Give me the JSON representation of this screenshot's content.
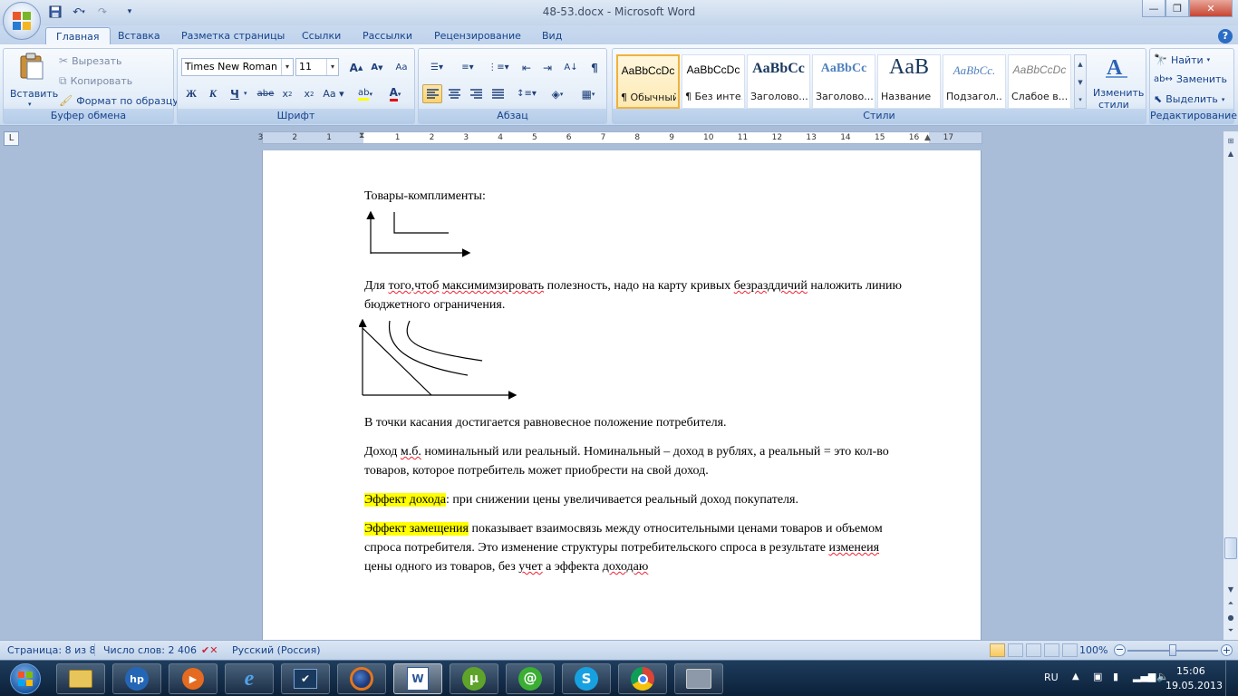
{
  "window": {
    "title": "48-53.docx - Microsoft Word"
  },
  "tabs": [
    {
      "label": "Главная",
      "active": true
    },
    {
      "label": "Вставка"
    },
    {
      "label": "Разметка страницы"
    },
    {
      "label": "Ссылки"
    },
    {
      "label": "Рассылки"
    },
    {
      "label": "Рецензирование"
    },
    {
      "label": "Вид"
    }
  ],
  "clipboard": {
    "paste": "Вставить",
    "cut": "Вырезать",
    "copy": "Копировать",
    "format_painter": "Формат по образцу",
    "label": "Буфер обмена"
  },
  "font": {
    "name": "Times New Roman",
    "size": "11",
    "label": "Шрифт"
  },
  "paragraph": {
    "label": "Абзац"
  },
  "styles": {
    "label": "Стили",
    "items": [
      {
        "sample": "AaBbCcDc",
        "name": "¶ Обычный",
        "selected": true
      },
      {
        "sample": "AaBbCcDc",
        "name": "¶ Без инте..."
      },
      {
        "sample": "AaBbCc",
        "name": "Заголово..."
      },
      {
        "sample": "AaBbCc",
        "name": "Заголово..."
      },
      {
        "sample": "AaB",
        "name": "Название"
      },
      {
        "sample": "AaBbCc.",
        "name": "Подзагол..."
      },
      {
        "sample": "AaBbCcDc",
        "name": "Слабое в..."
      }
    ],
    "change_styles_1": "Изменить",
    "change_styles_2": "стили"
  },
  "editing": {
    "find": "Найти",
    "replace": "Заменить",
    "select": "Выделить",
    "label": "Редактирование"
  },
  "ruler": {
    "numbers": [
      "3",
      "2",
      "1",
      "1",
      "2",
      "3",
      "4",
      "5",
      "6",
      "7",
      "8",
      "9",
      "10",
      "11",
      "12",
      "13",
      "14",
      "15",
      "16",
      "17"
    ]
  },
  "document": {
    "p1": "Товары-комплименты:",
    "p2a": "Для ",
    "p2b": "того,чтоб",
    "p2c": " ",
    "p2d": "максимимзировать",
    "p2e": " полезность, надо на карту кривых ",
    "p2f": "безразддичий",
    "p2g": " наложить линию",
    "p3": "бюджетного ограничения.",
    "p4": "В точки касания достигается равновесное положение потребителя.",
    "p5a": "Доход ",
    "p5b": "м.б.",
    "p5c": " номинальный или реальный. Номинальный – доход в рублях, а реальный = это кол-во",
    "p6": "товаров, которое потребитель может приобрести на свой доход.",
    "p7a": "Эффект дохода",
    "p7b": ": при снижении цены увеличивается реальный доход покупателя.",
    "p8a": "Эффект замещения",
    "p8b": " показывает взаимосвязь между относительными ценами товаров и объемом",
    "p9a": "спроса потребителя. Это изменение структуры потребительского спроса в результате ",
    "p9b": "изменеия",
    "p10a": "цены одного из товаров, без ",
    "p10b": "учет",
    "p10c": " а эффекта ",
    "p10d": "доходаю"
  },
  "status": {
    "page": "Страница: 8 из 8",
    "words": "Число слов: 2 406",
    "language": "Русский (Россия)",
    "zoom": "100%"
  },
  "taskbar": {
    "lang": "RU",
    "time": "15:06",
    "date": "19.05.2013"
  },
  "colors": {
    "highlight": "#ffff00",
    "accent": "#15428b"
  }
}
